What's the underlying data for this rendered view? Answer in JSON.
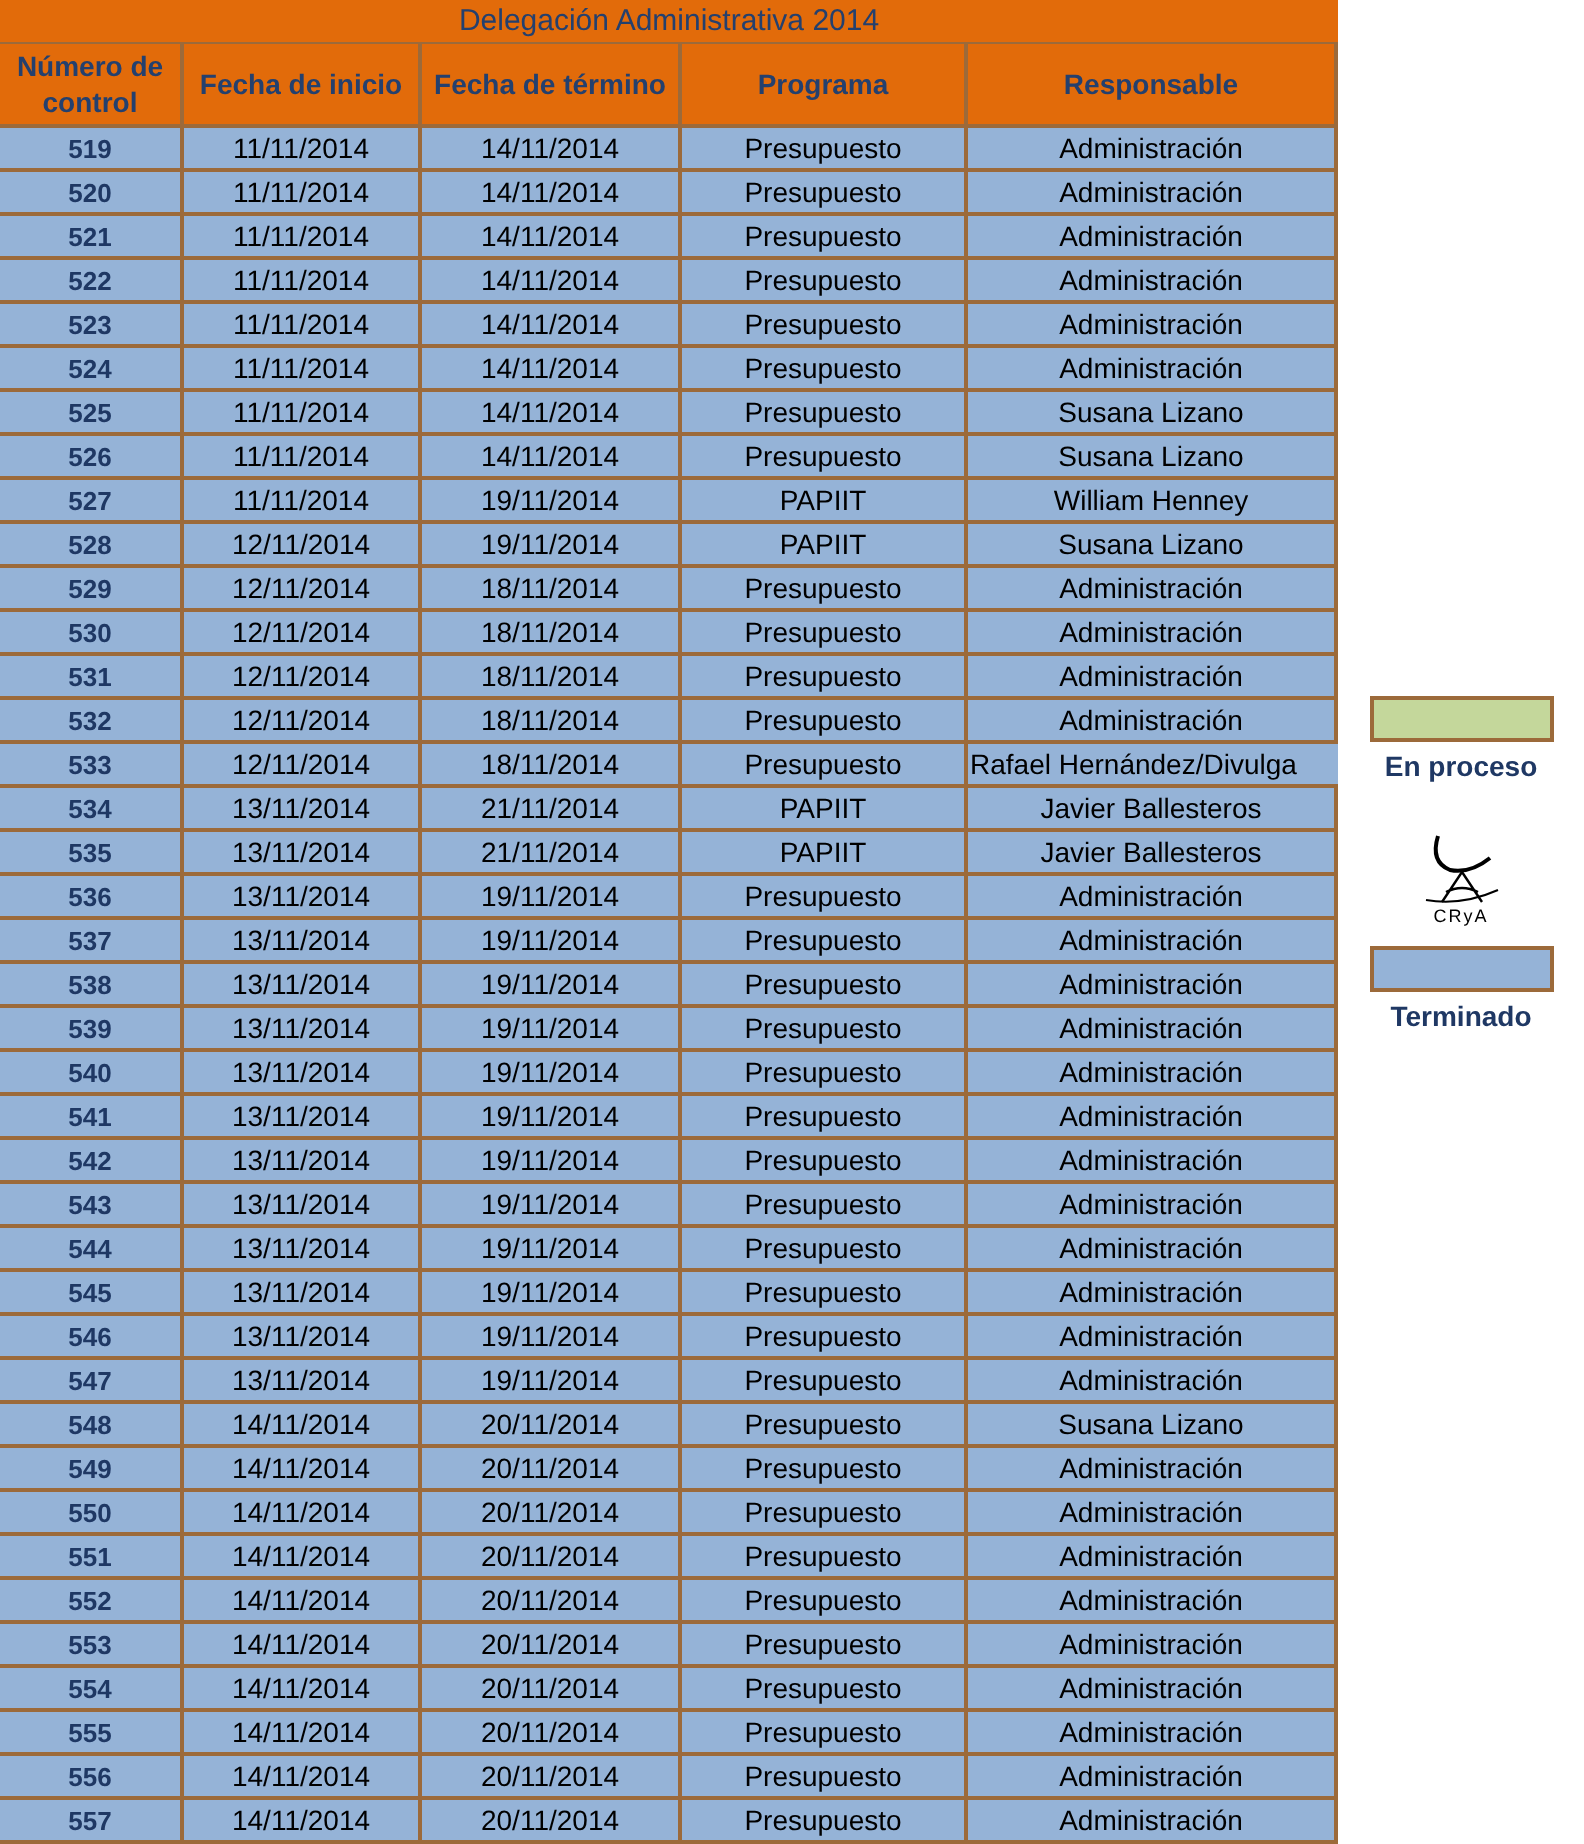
{
  "table": {
    "title": "Delegación Administrativa 2014",
    "columns": [
      "Número de control",
      "Fecha de inicio",
      "Fecha de término",
      "Programa",
      "Responsable"
    ],
    "rows": [
      {
        "control": "519",
        "start": "11/11/2014",
        "end": "14/11/2014",
        "program": "Presupuesto",
        "responsible": "Administración",
        "finished": true
      },
      {
        "control": "520",
        "start": "11/11/2014",
        "end": "14/11/2014",
        "program": "Presupuesto",
        "responsible": "Administración",
        "finished": true
      },
      {
        "control": "521",
        "start": "11/11/2014",
        "end": "14/11/2014",
        "program": "Presupuesto",
        "responsible": "Administración",
        "finished": true
      },
      {
        "control": "522",
        "start": "11/11/2014",
        "end": "14/11/2014",
        "program": "Presupuesto",
        "responsible": "Administración",
        "finished": true
      },
      {
        "control": "523",
        "start": "11/11/2014",
        "end": "14/11/2014",
        "program": "Presupuesto",
        "responsible": "Administración",
        "finished": true
      },
      {
        "control": "524",
        "start": "11/11/2014",
        "end": "14/11/2014",
        "program": "Presupuesto",
        "responsible": "Administración",
        "finished": true
      },
      {
        "control": "525",
        "start": "11/11/2014",
        "end": "14/11/2014",
        "program": "Presupuesto",
        "responsible": "Susana Lizano",
        "finished": true
      },
      {
        "control": "526",
        "start": "11/11/2014",
        "end": "14/11/2014",
        "program": "Presupuesto",
        "responsible": "Susana Lizano",
        "finished": true
      },
      {
        "control": "527",
        "start": "11/11/2014",
        "end": "19/11/2014",
        "program": "PAPIIT",
        "responsible": "William Henney",
        "finished": true
      },
      {
        "control": "528",
        "start": "12/11/2014",
        "end": "19/11/2014",
        "program": "PAPIIT",
        "responsible": "Susana Lizano",
        "finished": true
      },
      {
        "control": "529",
        "start": "12/11/2014",
        "end": "18/11/2014",
        "program": "Presupuesto",
        "responsible": "Administración",
        "finished": true
      },
      {
        "control": "530",
        "start": "12/11/2014",
        "end": "18/11/2014",
        "program": "Presupuesto",
        "responsible": "Administración",
        "finished": true
      },
      {
        "control": "531",
        "start": "12/11/2014",
        "end": "18/11/2014",
        "program": "Presupuesto",
        "responsible": "Administración",
        "finished": true
      },
      {
        "control": "532",
        "start": "12/11/2014",
        "end": "18/11/2014",
        "program": "Presupuesto",
        "responsible": "Administración",
        "finished": true
      },
      {
        "control": "533",
        "start": "12/11/2014",
        "end": "18/11/2014",
        "program": "Presupuesto",
        "responsible": "Rafael Hernández/Divulga",
        "finished": true
      },
      {
        "control": "534",
        "start": "13/11/2014",
        "end": "21/11/2014",
        "program": "PAPIIT",
        "responsible": "Javier Ballesteros",
        "finished": true
      },
      {
        "control": "535",
        "start": "13/11/2014",
        "end": "21/11/2014",
        "program": "PAPIIT",
        "responsible": "Javier Ballesteros",
        "finished": true
      },
      {
        "control": "536",
        "start": "13/11/2014",
        "end": "19/11/2014",
        "program": "Presupuesto",
        "responsible": "Administración",
        "finished": true
      },
      {
        "control": "537",
        "start": "13/11/2014",
        "end": "19/11/2014",
        "program": "Presupuesto",
        "responsible": "Administración",
        "finished": true
      },
      {
        "control": "538",
        "start": "13/11/2014",
        "end": "19/11/2014",
        "program": "Presupuesto",
        "responsible": "Administración",
        "finished": true
      },
      {
        "control": "539",
        "start": "13/11/2014",
        "end": "19/11/2014",
        "program": "Presupuesto",
        "responsible": "Administración",
        "finished": true
      },
      {
        "control": "540",
        "start": "13/11/2014",
        "end": "19/11/2014",
        "program": "Presupuesto",
        "responsible": "Administración",
        "finished": true
      },
      {
        "control": "541",
        "start": "13/11/2014",
        "end": "19/11/2014",
        "program": "Presupuesto",
        "responsible": "Administración",
        "finished": true
      },
      {
        "control": "542",
        "start": "13/11/2014",
        "end": "19/11/2014",
        "program": "Presupuesto",
        "responsible": "Administración",
        "finished": true
      },
      {
        "control": "543",
        "start": "13/11/2014",
        "end": "19/11/2014",
        "program": "Presupuesto",
        "responsible": "Administración",
        "finished": true
      },
      {
        "control": "544",
        "start": "13/11/2014",
        "end": "19/11/2014",
        "program": "Presupuesto",
        "responsible": "Administración",
        "finished": true
      },
      {
        "control": "545",
        "start": "13/11/2014",
        "end": "19/11/2014",
        "program": "Presupuesto",
        "responsible": "Administración",
        "finished": true
      },
      {
        "control": "546",
        "start": "13/11/2014",
        "end": "19/11/2014",
        "program": "Presupuesto",
        "responsible": "Administración",
        "finished": true
      },
      {
        "control": "547",
        "start": "13/11/2014",
        "end": "19/11/2014",
        "program": "Presupuesto",
        "responsible": "Administración",
        "finished": true
      },
      {
        "control": "548",
        "start": "14/11/2014",
        "end": "20/11/2014",
        "program": "Presupuesto",
        "responsible": "Susana Lizano",
        "finished": true
      },
      {
        "control": "549",
        "start": "14/11/2014",
        "end": "20/11/2014",
        "program": "Presupuesto",
        "responsible": "Administración",
        "finished": true
      },
      {
        "control": "550",
        "start": "14/11/2014",
        "end": "20/11/2014",
        "program": "Presupuesto",
        "responsible": "Administración",
        "finished": true
      },
      {
        "control": "551",
        "start": "14/11/2014",
        "end": "20/11/2014",
        "program": "Presupuesto",
        "responsible": "Administración",
        "finished": true
      },
      {
        "control": "552",
        "start": "14/11/2014",
        "end": "20/11/2014",
        "program": "Presupuesto",
        "responsible": "Administración",
        "finished": true
      },
      {
        "control": "553",
        "start": "14/11/2014",
        "end": "20/11/2014",
        "program": "Presupuesto",
        "responsible": "Administración",
        "finished": true
      },
      {
        "control": "554",
        "start": "14/11/2014",
        "end": "20/11/2014",
        "program": "Presupuesto",
        "responsible": "Administración",
        "finished": true
      },
      {
        "control": "555",
        "start": "14/11/2014",
        "end": "20/11/2014",
        "program": "Presupuesto",
        "responsible": "Administración",
        "finished": true
      },
      {
        "control": "556",
        "start": "14/11/2014",
        "end": "20/11/2014",
        "program": "Presupuesto",
        "responsible": "Administración",
        "finished": true
      },
      {
        "control": "557",
        "start": "14/11/2014",
        "end": "20/11/2014",
        "program": "Presupuesto",
        "responsible": "Administración",
        "finished": true
      }
    ]
  },
  "legend": {
    "items": [
      {
        "label": "En proceso",
        "color": "#c4d79b"
      },
      {
        "label": "Terminado",
        "color": "#95b3d7"
      }
    ],
    "logo": {
      "text": "CRyA"
    }
  }
}
